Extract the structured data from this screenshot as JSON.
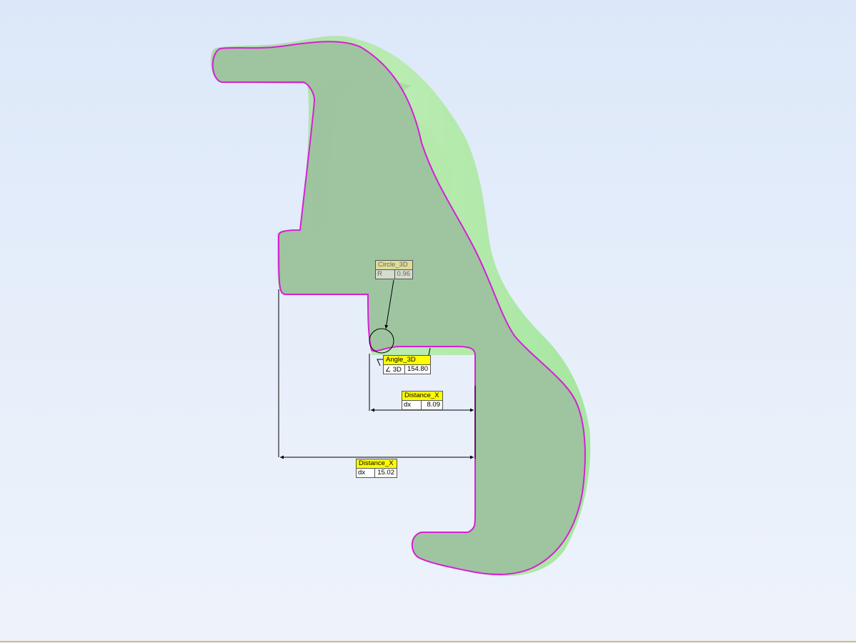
{
  "measurements": {
    "circle": {
      "title": "Circle_3D",
      "key": "R",
      "value": "0.96"
    },
    "angle": {
      "title": "Angle_3D",
      "key": "3D",
      "value": "154.80",
      "key_icon": "angle-icon"
    },
    "distance_small": {
      "title": "Distance_X",
      "key": "dx",
      "value": "8.09"
    },
    "distance_large": {
      "title": "Distance_X",
      "key": "dx",
      "value": "15.02"
    }
  },
  "colors": {
    "background_top": "#dce8f9",
    "background_bottom": "#eef3fb",
    "part_fill": "#9fc8a2",
    "part_highlight": "#a8ef9c",
    "section_outline": "#d61fd6",
    "label_fill": "#ffff00",
    "dimension_line": "#000000"
  }
}
